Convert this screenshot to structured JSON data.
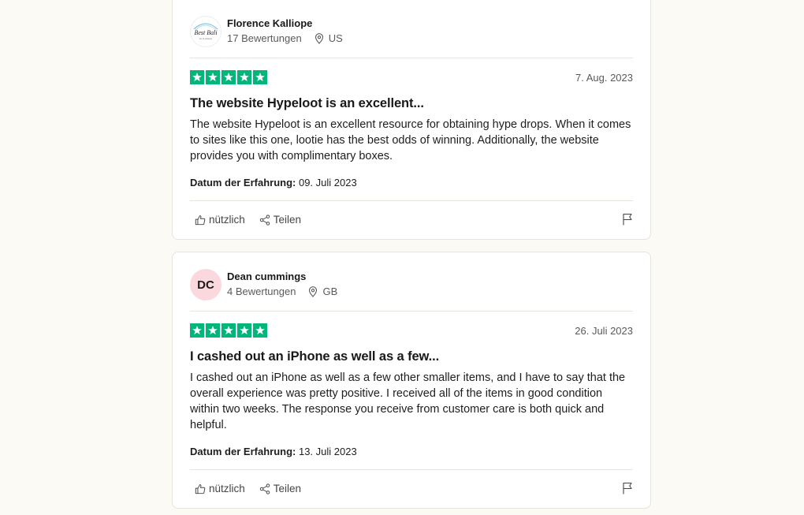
{
  "reviews": [
    {
      "reviewer_name": "Florence Kalliope",
      "review_count": "17 Bewertungen",
      "country": "US",
      "avatar_type": "logo",
      "avatar_logo_text": "Best Bali",
      "avatar_logo_subtext": "Art of Lifestyle",
      "rating": 5,
      "date": "7. Aug. 2023",
      "title": "The website Hypeloot is an excellent...",
      "body": "The website Hypeloot is an excellent resource for obtaining hype drops. When it comes to sites like this one, lootie has the best odds of winning. Additionally, the website provides you with complimentary boxes.",
      "experience_label": "Datum der Erfahrung:",
      "experience_date": "09. Juli 2023",
      "useful_label": "nützlich",
      "share_label": "Teilen"
    },
    {
      "reviewer_name": "Dean cummings",
      "review_count": "4 Bewertungen",
      "country": "GB",
      "avatar_type": "initials",
      "avatar_initials": "DC",
      "rating": 5,
      "date": "26. Juli 2023",
      "title": "I cashed out an iPhone as well as a few...",
      "body": "I cashed out an iPhone as well as a few other smaller items, and I have to say that the overall experience was pretty positive. I received all of the items in good condition within two weeks. The response you receive from customer care is both quick and helpful.",
      "experience_label": "Datum der Erfahrung:",
      "experience_date": "13. Juli 2023",
      "useful_label": "nützlich",
      "share_label": "Teilen"
    }
  ],
  "colors": {
    "star_green": "#00b67a",
    "avatar_pink": "#fbd7de",
    "page_background": "#fbfaf4"
  },
  "icons": {
    "location": "location-pin-icon",
    "useful": "thumbs-up-icon",
    "share": "share-icon",
    "report": "flag-icon",
    "star": "star-icon"
  }
}
